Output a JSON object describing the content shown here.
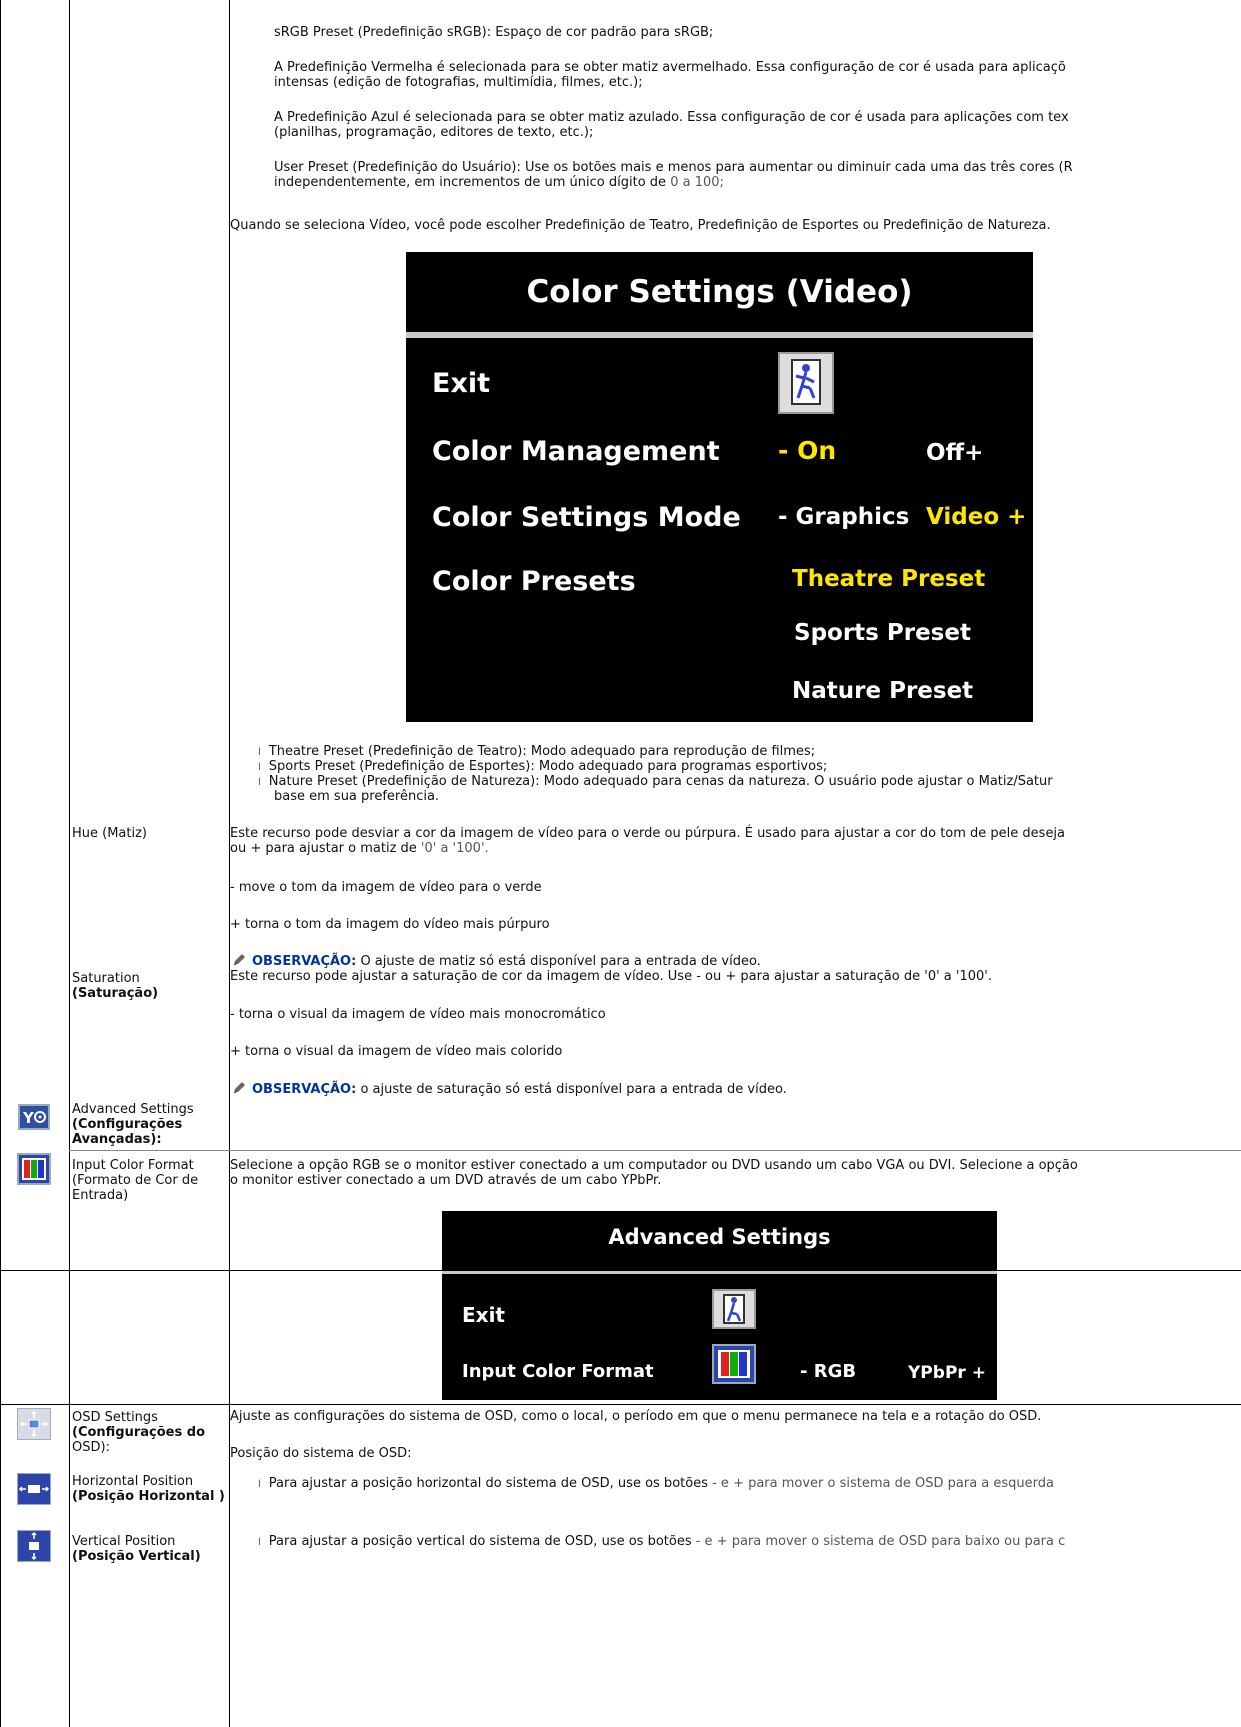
{
  "color_presets_graphics": {
    "srgb": "sRGB Preset (Predefinição sRGB):  Espaço de cor padrão para sRGB;",
    "red_line1": "A Predefinição Vermelha é selecionada para se obter matiz avermelhado. Essa configuração de cor é usada para aplicaçõ",
    "red_line2": "intensas (edição de fotografias, multimídia, filmes, etc.);",
    "blue_line1": "A Predefinição Azul é selecionada para se obter matiz azulado. Essa configuração de cor é usada para aplicações com tex",
    "blue_line2": "(planilhas, programação, editores de texto, etc.);",
    "user_line1": "User Preset (Predefinição do Usuário): Use os botões mais e menos para aumentar ou diminuir cada uma das três cores (R",
    "user_line2a": "independentemente, em incrementos de um único dígito de ",
    "user_line2b": "0 a 100;"
  },
  "video_intro": "Quando se seleciona Vídeo, você pode escolher Predefinição de Teatro, Predefinição de Esportes ou Predefinição de Natureza.",
  "osd_color_video": {
    "title": "Color Settings (Video)",
    "rows": {
      "exit": "Exit",
      "color_management": "Color Management",
      "cm_on": "- On",
      "cm_off": "Off+",
      "color_settings_mode": "Color Settings Mode",
      "csm_graphics": "- Graphics",
      "csm_video": "Video +",
      "color_presets": "Color Presets",
      "theatre": "Theatre Preset",
      "sports": "Sports Preset",
      "nature": "Nature Preset"
    },
    "colors": {
      "yellow": "#ffe600",
      "background": "#000000"
    }
  },
  "video_presets": {
    "bullet": "l",
    "theatre": "Theatre Preset (Predefinição de Teatro): Modo adequado para reprodução de filmes;",
    "sports": "Sports Preset (Predefinição de Esportes): Modo adequado para programas esportivos;",
    "nature_line1": "Nature Preset (Predefinição de Natureza): Modo adequado para cenas da natureza. O usuário pode ajustar o Matiz/Satur",
    "nature_line2": "base em sua preferência."
  },
  "hue": {
    "label": "Hue (Matiz)",
    "desc_line1": "Este recurso pode desviar a cor da imagem de vídeo para o verde ou púrpura. É usado para ajustar a cor do tom de pele deseja",
    "desc_line2a": "ou + para ajustar o matiz de ",
    "desc_line2b": "'0' a '100'.",
    "minus": "- move o tom da imagem de vídeo para o verde",
    "plus": "+ torna o tom da imagem do vídeo mais púrpuro",
    "note_label": "OBSERVAÇÃO:",
    "note_text": " O ajuste de matiz só está disponível para a entrada de vídeo."
  },
  "saturation": {
    "label_line1": "Saturation",
    "label_line2": "(Saturação)",
    "desc": "Este recurso pode ajustar a saturação de cor da imagem de vídeo. Use - ou + para ajustar a saturação de '0' a '100'.",
    "minus": "- torna o visual da imagem de vídeo mais monocromático",
    "plus": "+ torna o visual da imagem de vídeo mais colorido",
    "note_label": "OBSERVAÇÃO:",
    "note_text": " o ajuste de saturação só está disponível para a entrada de vídeo."
  },
  "advanced": {
    "label_line1": "Advanced Settings",
    "label_line2": "(Configurações",
    "label_line3": "Avançadas):"
  },
  "input_color_format": {
    "label_line1": "Input Color Format",
    "label_line2": "(Formato de Cor de",
    "label_line3": "Entrada)",
    "desc_line1": "Selecione a opção RGB se o monitor estiver conectado a um computador ou DVD usando um cabo VGA ou DVI. Selecione a opção",
    "desc_line2": "o monitor estiver conectado a um DVD através de um cabo YPbPr."
  },
  "osd_advanced": {
    "title": "Advanced Settings",
    "exit": "Exit",
    "input_color_format": "Input Color Format",
    "rgb": "- RGB",
    "ypbpr": "YPbPr +"
  },
  "osd_settings": {
    "label_line1": "OSD Settings",
    "label_line2": "(Configurações do",
    "label_line3": "OSD):",
    "desc": "Ajuste as configurações do sistema de OSD, como o local, o período em que o menu permanece na tela e a rotação do OSD.",
    "position_intro": "Posição do sistema de OSD:"
  },
  "horizontal_position": {
    "label_line1": "Horizontal Position",
    "label_line2": "(Posição Horizontal )",
    "text_a": "Para ajustar a posição horizontal do sistema de OSD, use os botões ",
    "text_b": "- e + para mover o sistema de OSD para a esquerda"
  },
  "vertical_position": {
    "label_line1": "Vertical Position",
    "label_line2": "(Posição Vertical)",
    "text_a": "Para ajustar a posição vertical do sistema de OSD, use os botões ",
    "text_b": "- e + para mover o sistema de OSD para baixo ou para c"
  }
}
